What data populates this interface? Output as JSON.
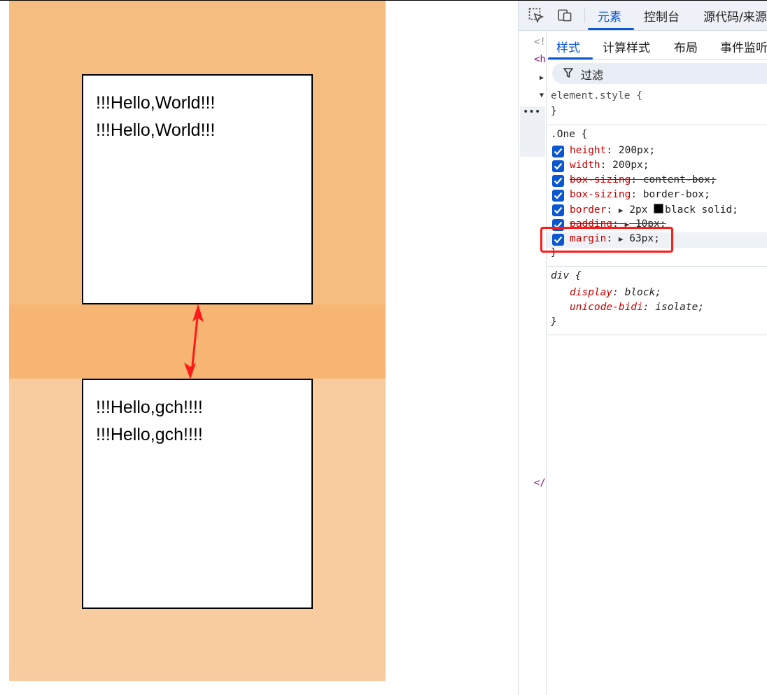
{
  "page": {
    "box1": {
      "lines": [
        "!!!Hello,World!!!",
        "!!!Hello,World!!!"
      ]
    },
    "box2": {
      "lines": [
        "!!!Hello,gch!!!!",
        "!!!Hello,gch!!!!"
      ]
    }
  },
  "devtools": {
    "top_tabs": [
      "元素",
      "控制台",
      "源代码/来源"
    ],
    "active_top_tab": "元素",
    "gutter": {
      "doctype": "<!",
      "html_open": "<h",
      "close": "</"
    },
    "sub_tabs": [
      "样式",
      "计算样式",
      "布局",
      "事件监听器"
    ],
    "active_sub_tab": "样式",
    "filter_placeholder": "过滤",
    "element_style": {
      "selector": "element.style {",
      "close": "}"
    },
    "one_rule": {
      "selector": ".One {",
      "close": "}",
      "properties": [
        {
          "name": "height",
          "value": "200px;",
          "checked": true,
          "struck": false,
          "expandable": false
        },
        {
          "name": "width",
          "value": "200px;",
          "checked": true,
          "struck": false,
          "expandable": false
        },
        {
          "name": "box-sizing",
          "value": "content-box;",
          "checked": true,
          "struck": true,
          "expandable": false
        },
        {
          "name": "box-sizing",
          "value": "border-box;",
          "checked": true,
          "struck": false,
          "expandable": false
        },
        {
          "name": "border",
          "value": "2px",
          "value_color": "black",
          "value_rest": "black solid;",
          "checked": true,
          "struck": false,
          "expandable": true
        },
        {
          "name": "padding",
          "value": "10px;",
          "checked": true,
          "struck": true,
          "expandable": true
        },
        {
          "name": "margin",
          "value": "63px;",
          "checked": true,
          "struck": false,
          "expandable": true
        }
      ]
    },
    "div_rule": {
      "selector": "div {",
      "close": "}",
      "properties": [
        {
          "name": "display",
          "value": "block;"
        },
        {
          "name": "unicode-bidi",
          "value": "isolate;"
        }
      ]
    }
  },
  "colors": {
    "margin_highlight": "#f6bd80",
    "overlap_highlight": "#f7b573",
    "margin_highlight_light": "#f8cc9f",
    "accent": "#0b57d0",
    "annotation_red": "#ff1a1a"
  }
}
